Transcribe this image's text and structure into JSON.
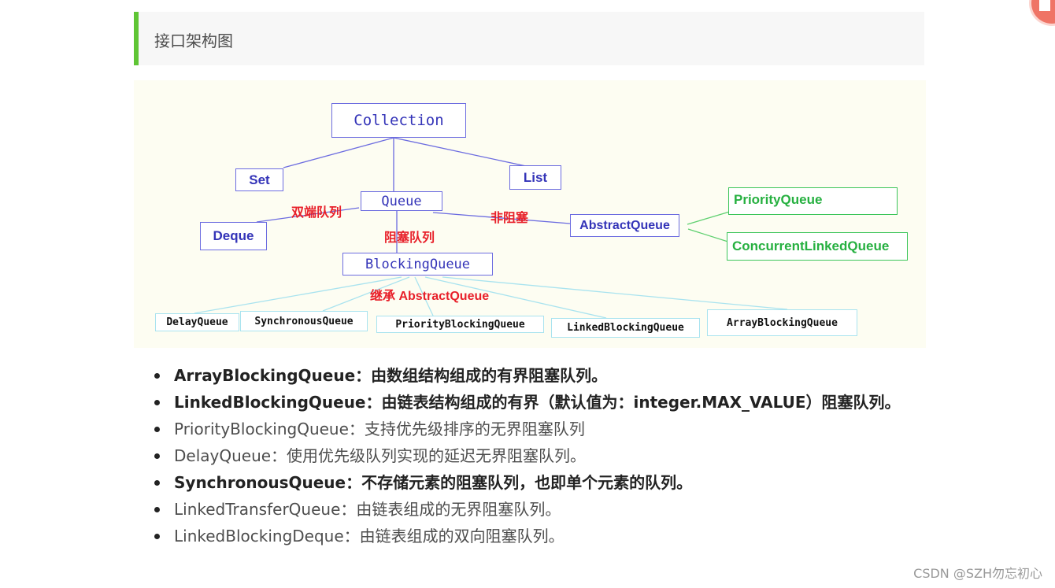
{
  "heading": "接口架构图",
  "diagram": {
    "nodes": {
      "collection": "Collection",
      "set": "Set",
      "list": "List",
      "queue": "Queue",
      "deque": "Deque",
      "abstract_queue": "AbstractQueue",
      "priority_queue": "PriorityQueue",
      "concurrent_linked_queue": "ConcurrentLinkedQueue",
      "blocking_queue": "BlockingQueue",
      "delay_queue": "DelayQueue",
      "synchronous_queue": "SynchronousQueue",
      "priority_blocking_queue": "PriorityBlockingQueue",
      "linked_blocking_queue": "LinkedBlockingQueue",
      "array_blocking_queue": "ArrayBlockingQueue"
    },
    "edge_labels": {
      "deque": "双端队列",
      "blocking": "阻塞队列",
      "non_blocking": "非阻塞",
      "extends": "继承 AbstractQueue"
    }
  },
  "items": [
    {
      "text": "ArrayBlockingQueue：由数组结构组成的有界阻塞队列。",
      "bold": true
    },
    {
      "text": "LinkedBlockingQueue：由链表结构组成的有界（默认值为：integer.MAX_VALUE）阻塞队列。",
      "bold": true
    },
    {
      "text": "PriorityBlockingQueue：支持优先级排序的无界阻塞队列",
      "bold": false
    },
    {
      "text": "DelayQueue：使用优先级队列实现的延迟无界阻塞队列。",
      "bold": false
    },
    {
      "text": "SynchronousQueue：不存储元素的阻塞队列，也即单个元素的队列。",
      "bold": true
    },
    {
      "text": "LinkedTransferQueue：由链表组成的无界阻塞队列。",
      "bold": false
    },
    {
      "text": "LinkedBlockingDeque：由链表组成的双向阻塞队列。",
      "bold": false
    }
  ],
  "watermark": "CSDN @SZH勿忘初心",
  "colors": {
    "accent_bar": "#5fc535",
    "node_blue": "#3434b8",
    "node_green": "#26b040",
    "label_red": "#e8202a"
  }
}
